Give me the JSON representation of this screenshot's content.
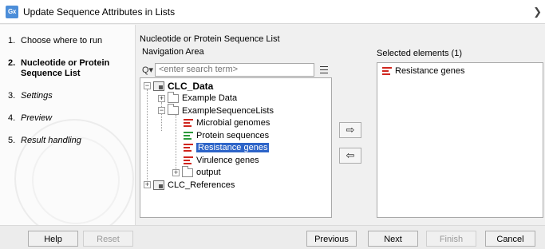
{
  "window": {
    "icon_text": "Gx",
    "title": "Update Sequence Attributes in Lists",
    "close_glyph": "❯"
  },
  "sidebar": {
    "steps": [
      {
        "num": "1.",
        "label": "Choose where to run"
      },
      {
        "num": "2.",
        "label": "Nucleotide or Protein Sequence List"
      },
      {
        "num": "3.",
        "label": "Settings"
      },
      {
        "num": "4.",
        "label": "Preview"
      },
      {
        "num": "5.",
        "label": "Result handling"
      }
    ]
  },
  "main": {
    "section_title": "Nucleotide or Protein Sequence List",
    "navigation_label": "Navigation Area",
    "search": {
      "icon": "Q▾",
      "placeholder": "<enter search term>",
      "value": ""
    },
    "tree": {
      "root": "CLC_Data",
      "items": [
        "Example Data",
        "ExampleSequenceLists",
        "Microbial genomes",
        "Protein sequences",
        "Resistance genes",
        "Virulence genes",
        "output",
        "CLC_References"
      ],
      "expander_plus": "+",
      "expander_minus": "−"
    },
    "move_right_glyph": "⇨",
    "move_left_glyph": "⇦",
    "selected": {
      "title": "Selected elements (1)",
      "items": [
        "Resistance genes"
      ]
    }
  },
  "footer": {
    "help": "Help",
    "reset": "Reset",
    "previous": "Previous",
    "next": "Next",
    "finish": "Finish",
    "cancel": "Cancel"
  },
  "colors": {
    "selection": "#2d64c8",
    "sequence_red": "#d0261e",
    "sequence_green": "#2b9a3a",
    "app_icon": "#4c8ed9"
  }
}
